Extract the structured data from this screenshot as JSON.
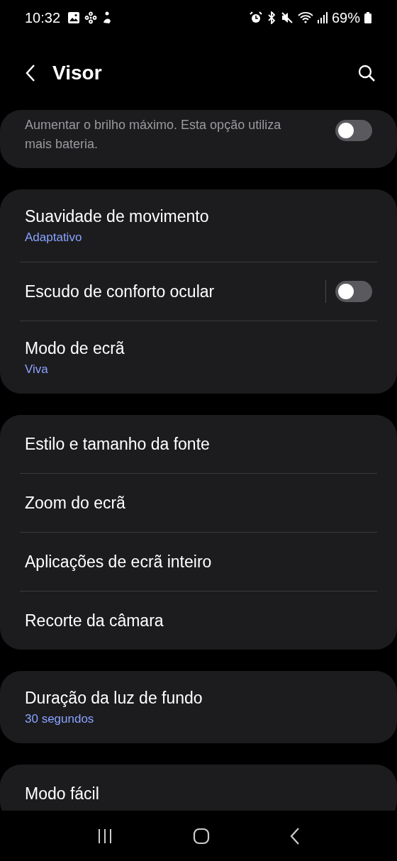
{
  "status_bar": {
    "time": "10:32",
    "battery": "69%"
  },
  "header": {
    "title": "Visor"
  },
  "sections": [
    {
      "items": [
        {
          "kind": "switch",
          "description": "Aumentar o brilho máximo. Esta opção utiliza mais bateria.",
          "on": false
        }
      ]
    },
    {
      "items": [
        {
          "kind": "link",
          "title": "Suavidade de movimento",
          "subtitle": "Adaptativo"
        },
        {
          "kind": "split_switch",
          "title": "Escudo de conforto ocular",
          "on": false
        },
        {
          "kind": "link",
          "title": "Modo de ecrã",
          "subtitle": "Viva"
        }
      ]
    },
    {
      "items": [
        {
          "kind": "link",
          "title": "Estilo e tamanho da fonte"
        },
        {
          "kind": "link",
          "title": "Zoom do ecrã"
        },
        {
          "kind": "link",
          "title": "Aplicações de ecrã inteiro"
        },
        {
          "kind": "link",
          "title": "Recorte da câmara"
        }
      ]
    },
    {
      "items": [
        {
          "kind": "link",
          "title": "Duração da luz de fundo",
          "subtitle": "30 segundos"
        }
      ]
    },
    {
      "items": [
        {
          "kind": "link",
          "title": "Modo fácil"
        }
      ]
    }
  ]
}
